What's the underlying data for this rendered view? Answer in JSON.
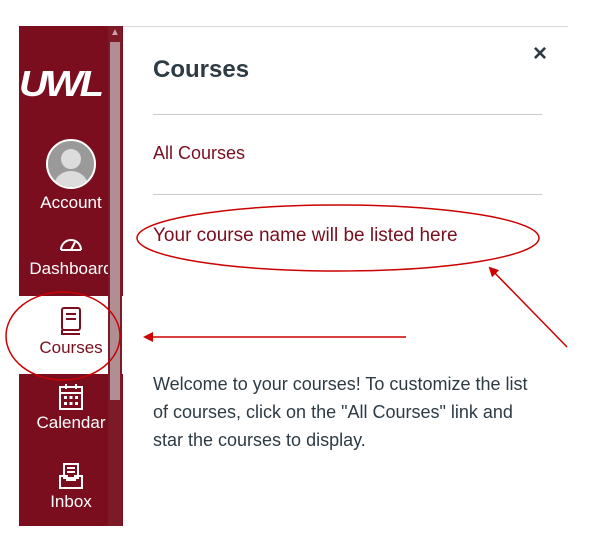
{
  "nav": {
    "logo_text": "UWL",
    "items": [
      {
        "label": "Account",
        "icon": "user-avatar-icon"
      },
      {
        "label": "Dashboard",
        "icon": "dashboard-gauge-icon"
      },
      {
        "label": "Courses",
        "icon": "book-icon",
        "active": true
      },
      {
        "label": "Calendar",
        "icon": "calendar-icon"
      },
      {
        "label": "Inbox",
        "icon": "inbox-icon"
      }
    ]
  },
  "tray": {
    "title": "Courses",
    "all_courses_link": "All Courses",
    "course_placeholder": "Your course name will be listed here",
    "welcome_text": "Welcome to your courses! To customize the list of courses, click on the \"All Courses\" link and star the courses to display.",
    "close_symbol": "×"
  },
  "colors": {
    "brand": "#7a0e1e",
    "annotation": "#cc0000",
    "text": "#2d3b45"
  }
}
